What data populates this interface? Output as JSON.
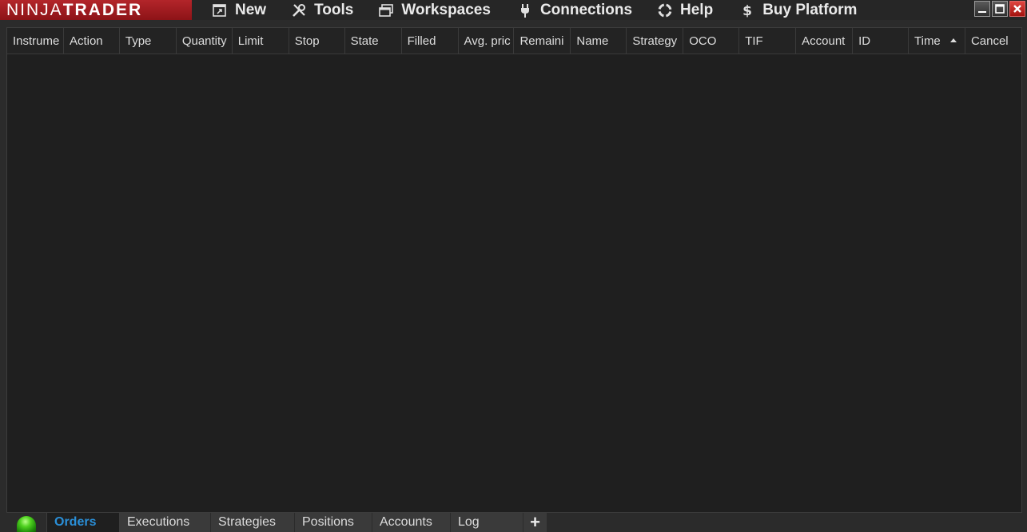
{
  "app": {
    "logo_part1": "NINJA",
    "logo_part2": "TRADER"
  },
  "menu": [
    {
      "label": "New",
      "icon": "new-window-icon"
    },
    {
      "label": "Tools",
      "icon": "tools-icon"
    },
    {
      "label": "Workspaces",
      "icon": "workspaces-icon"
    },
    {
      "label": "Connections",
      "icon": "plug-icon"
    },
    {
      "label": "Help",
      "icon": "lifebuoy-icon"
    },
    {
      "label": "Buy Platform",
      "icon": "dollar-icon"
    }
  ],
  "grid": {
    "columns": [
      {
        "label": "Instrume"
      },
      {
        "label": "Action"
      },
      {
        "label": "Type"
      },
      {
        "label": "Quantity"
      },
      {
        "label": "Limit"
      },
      {
        "label": "Stop"
      },
      {
        "label": "State"
      },
      {
        "label": "Filled"
      },
      {
        "label": "Avg. pric"
      },
      {
        "label": "Remaini"
      },
      {
        "label": "Name"
      },
      {
        "label": "Strategy"
      },
      {
        "label": "OCO"
      },
      {
        "label": "TIF"
      },
      {
        "label": "Account"
      },
      {
        "label": "ID"
      },
      {
        "label": "Time",
        "sort": "ascending"
      },
      {
        "label": "Cancel"
      }
    ],
    "rows": []
  },
  "tabs": [
    {
      "label": "Orders",
      "active": true
    },
    {
      "label": "Executions"
    },
    {
      "label": "Strategies"
    },
    {
      "label": "Positions"
    },
    {
      "label": "Accounts"
    },
    {
      "label": "Log"
    }
  ],
  "add_tab_label": "+",
  "colors": {
    "brand_red": "#b3252a",
    "active_tab_text": "#2a8fd8",
    "status_ok": "#4fd21f"
  }
}
